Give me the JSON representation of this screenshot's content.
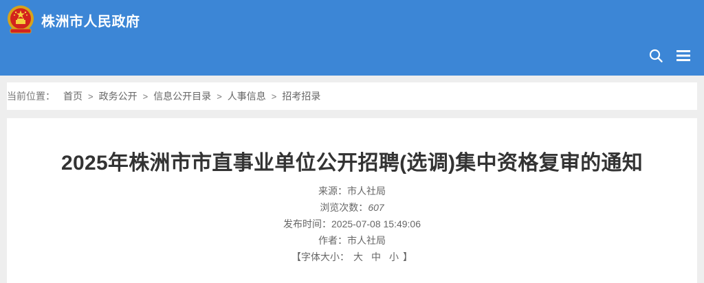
{
  "header": {
    "site_title": "株洲市人民政府",
    "bg_color": "#3c86d6",
    "icons": [
      "emblem-icon",
      "search-icon",
      "menu-icon"
    ]
  },
  "breadcrumb": {
    "label": "当前位置：",
    "items": [
      "首页",
      "政务公开",
      "信息公开目录",
      "人事信息",
      "招考招录"
    ],
    "separator": ">"
  },
  "article": {
    "title": "2025年株洲市市直事业单位公开招聘(选调)集中资格复审的通知",
    "source_label": "来源：",
    "source_value": "市人社局",
    "views_label": "浏览次数：",
    "views_value": "607",
    "published_label": "发布时间：",
    "published_value": "2025-07-08 15:49:06",
    "author_label": "作者：",
    "author_value": "市人社局",
    "font_size_label": "【字体大小：",
    "font_size_options": [
      "大",
      "中",
      "小"
    ],
    "font_size_close": "】"
  }
}
